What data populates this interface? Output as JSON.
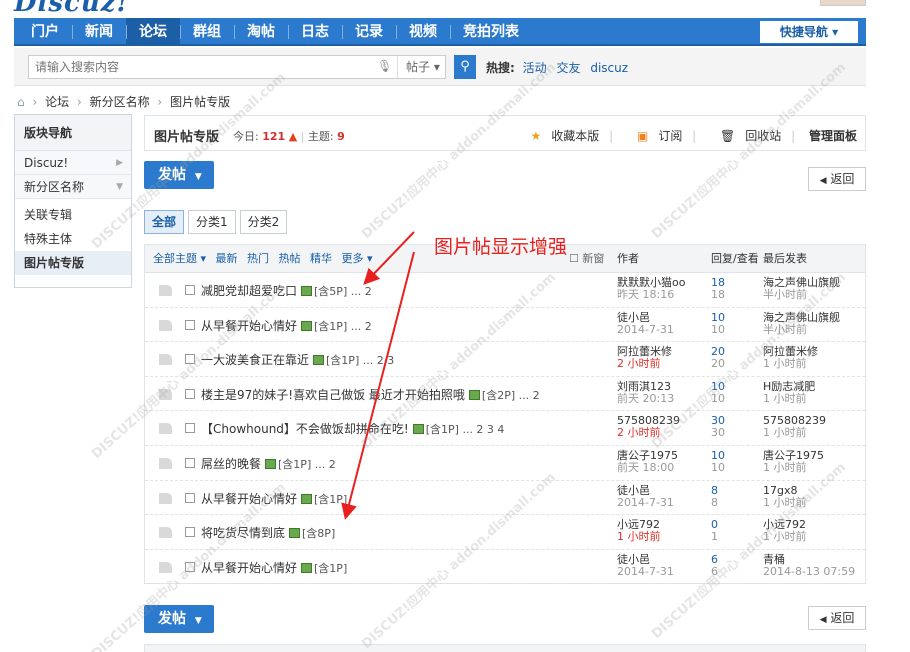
{
  "logo": "Discuz!",
  "nav": {
    "items": [
      "门户",
      "新闻",
      "论坛",
      "群组",
      "淘帖",
      "日志",
      "记录",
      "视频",
      "竞拍列表"
    ],
    "active_index": 2,
    "quick_nav": "快捷导航 ▾"
  },
  "search": {
    "placeholder": "请输入搜索内容",
    "scope": "帖子 ▾",
    "hot_label": "热搜:",
    "hot_terms": [
      "活动",
      "交友",
      "discuz"
    ]
  },
  "breadcrumb": [
    "论坛",
    "新分区名称",
    "图片帖专版"
  ],
  "sidebar": {
    "title": "版块导航",
    "categories": [
      "Discuz!",
      "新分区名称"
    ],
    "items": [
      "关联专辑",
      "特殊主体",
      "图片帖专版"
    ],
    "active_item": 2
  },
  "forum": {
    "title": "图片帖专版",
    "today_label": "今日:",
    "today_count": "121",
    "topic_label": "主题:",
    "topic_count": "9",
    "actions": [
      "收藏本版",
      "订阅",
      "回收站",
      "管理面板"
    ]
  },
  "buttons": {
    "post": "发帖",
    "back": "返回"
  },
  "category_tabs": [
    "全部",
    "分类1",
    "分类2"
  ],
  "list_header": {
    "filters": [
      "全部主题 ▾",
      "最新",
      "热门",
      "热帖",
      "精华",
      "更多 ▾"
    ],
    "newest": "新窗",
    "author": "作者",
    "counts": "回复/查看",
    "last": "最后发表"
  },
  "annotation": "图片帖显示增强",
  "threads": [
    {
      "title": "减肥党却超爱吃口",
      "meta": "[含5P] ... 2",
      "author": "默默默小猫oo",
      "author_time": "昨天 18:16",
      "author_time_red": false,
      "replies": "18",
      "views": "18",
      "last_user": "海之声佛山旗舰",
      "last_time": "半小时前"
    },
    {
      "title": "从早餐开始心情好",
      "meta": "[含1P] ... 2",
      "author": "徒小邑",
      "author_time": "2014-7-31",
      "author_time_red": false,
      "replies": "10",
      "views": "10",
      "last_user": "海之声佛山旗舰",
      "last_time": "半小时前"
    },
    {
      "title": "一大波美食正在靠近",
      "meta": "[含1P] ... 2  3",
      "author": "阿拉蕾米修",
      "author_time": "2 小时前",
      "author_time_red": true,
      "replies": "20",
      "views": "20",
      "last_user": "阿拉蕾米修",
      "last_time": "1 小时前"
    },
    {
      "title": "楼主是97的妹子!喜欢自己做饭 最近才开始拍照哦",
      "meta": "[含2P] ... 2",
      "author": "刘雨淇123",
      "author_time": "前天 20:13",
      "author_time_red": false,
      "replies": "10",
      "views": "10",
      "last_user": "H励志减肥",
      "last_time": "1 小时前"
    },
    {
      "title": "【Chowhound】不会做饭却拼命在吃!",
      "meta": "[含1P] ... 2  3  4",
      "author": "575808239",
      "author_time": "2 小时前",
      "author_time_red": true,
      "replies": "30",
      "views": "30",
      "last_user": "575808239",
      "last_time": "1 小时前"
    },
    {
      "title": "屌丝的晚餐",
      "meta": "[含1P] ... 2",
      "author": "唐公子1975",
      "author_time": "前天 18:00",
      "author_time_red": false,
      "replies": "10",
      "views": "10",
      "last_user": "唐公子1975",
      "last_time": "1 小时前"
    },
    {
      "title": "从早餐开始心情好",
      "meta": "[含1P]",
      "author": "徒小邑",
      "author_time": "2014-7-31",
      "author_time_red": false,
      "replies": "8",
      "views": "8",
      "last_user": "17gx8",
      "last_time": "1 小时前"
    },
    {
      "title": "将吃货尽情到底",
      "meta": "[含8P]",
      "author": "小远792",
      "author_time": "1 小时前",
      "author_time_red": true,
      "replies": "0",
      "views": "1",
      "last_user": "小远792",
      "last_time": "1 小时前"
    },
    {
      "title": "从早餐开始心情好",
      "meta": "[含1P]",
      "author": "徒小邑",
      "author_time": "2014-7-31",
      "author_time_red": false,
      "replies": "6",
      "views": "6",
      "last_user": "青桶",
      "last_time": "2014-8-13 07:59"
    }
  ],
  "watermark": "DISCUZ!应用中心 addon.dismall.com"
}
